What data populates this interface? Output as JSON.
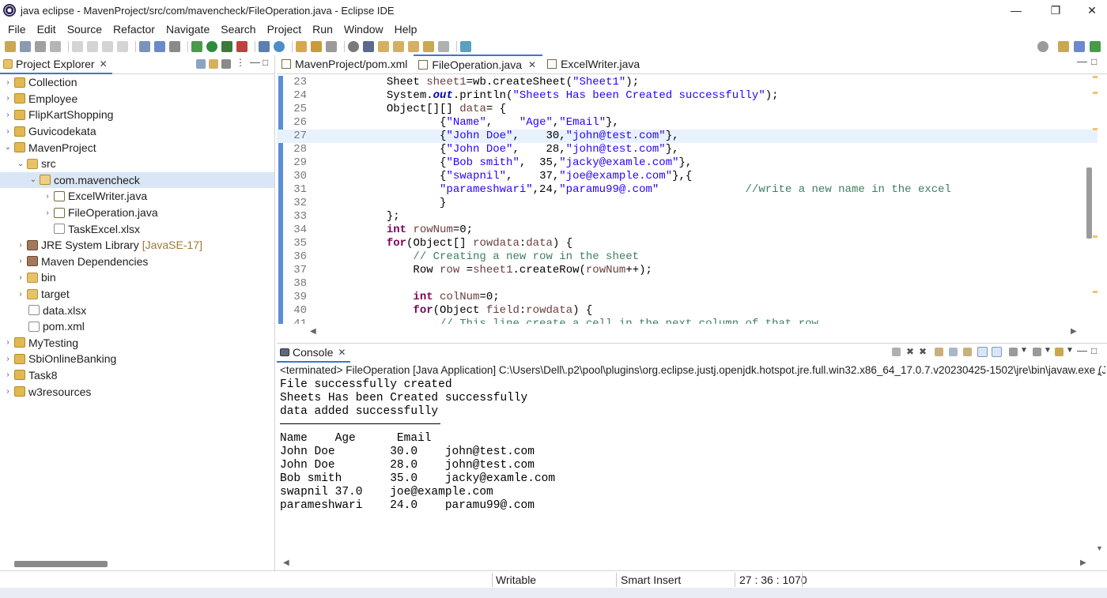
{
  "window": {
    "title": "java eclipse - MavenProject/src/com/mavencheck/FileOperation.java - Eclipse IDE",
    "minimize": "—",
    "maximize": "❐",
    "close": "✕"
  },
  "menu": [
    "File",
    "Edit",
    "Source",
    "Refactor",
    "Navigate",
    "Search",
    "Project",
    "Run",
    "Window",
    "Help"
  ],
  "project_explorer": {
    "tab_label": "Project Explorer",
    "items": [
      {
        "label": "Collection",
        "chev": "›",
        "icon": "project-icon"
      },
      {
        "label": "Employee",
        "chev": "›",
        "icon": "project-icon"
      },
      {
        "label": "FlipKartShopping",
        "chev": "›",
        "icon": "project-icon"
      },
      {
        "label": "Guvicodekata",
        "chev": "›",
        "icon": "project-icon"
      },
      {
        "label": "MavenProject",
        "chev": "⌄",
        "icon": "project-icon"
      },
      {
        "label": "src",
        "chev": "⌄",
        "icon": "folder-icon"
      },
      {
        "label": "com.mavencheck",
        "chev": "⌄",
        "icon": "package-icon"
      },
      {
        "label": "ExcelWriter.java",
        "chev": "›",
        "icon": "java-file-icon"
      },
      {
        "label": "FileOperation.java",
        "chev": "›",
        "icon": "java-file-icon"
      },
      {
        "label": "TaskExcel.xlsx",
        "chev": "",
        "icon": "xlsx-file-icon"
      },
      {
        "label": "JRE System Library",
        "suffix": "[JavaSE-17]",
        "chev": "›",
        "icon": "library-icon"
      },
      {
        "label": "Maven Dependencies",
        "chev": "›",
        "icon": "library-icon"
      },
      {
        "label": "bin",
        "chev": "›",
        "icon": "folder-icon"
      },
      {
        "label": "target",
        "chev": "›",
        "icon": "folder-icon"
      },
      {
        "label": "data.xlsx",
        "chev": "",
        "icon": "xlsx-file-icon"
      },
      {
        "label": "pom.xml",
        "chev": "",
        "icon": "xml-file-icon"
      },
      {
        "label": "MyTesting",
        "chev": "›",
        "icon": "project-icon"
      },
      {
        "label": "SbiOnlineBanking",
        "chev": "›",
        "icon": "project-icon"
      },
      {
        "label": "Task8",
        "chev": "›",
        "icon": "project-icon"
      },
      {
        "label": "w3resources",
        "chev": "›",
        "icon": "project-icon"
      }
    ]
  },
  "editor": {
    "tabs": [
      {
        "label": "MavenProject/pom.xml",
        "active": false
      },
      {
        "label": "FileOperation.java",
        "active": true
      },
      {
        "label": "ExcelWriter.java",
        "active": false
      }
    ],
    "line_numbers": [
      "23",
      "24",
      "25",
      "26",
      "27",
      "28",
      "29",
      "30",
      "31",
      "32",
      "33",
      "34",
      "35",
      "36",
      "37",
      "38",
      "39",
      "40",
      "41"
    ],
    "current_line": "27"
  },
  "console": {
    "tab_label": "Console",
    "description": "<terminated> FileOperation [Java Application] C:\\Users\\Dell\\.p2\\pool\\plugins\\org.eclipse.justj.openjdk.hotspot.jre.full.win32.x86_64_17.0.7.v20230425-1502\\jre\\bin\\javaw.exe  (Jun",
    "lines_before_rule": [
      "File successfully created",
      "Sheets Has been Created successfully",
      "data added successfully"
    ],
    "lines_after_rule": [
      "Name    Age      Email",
      "John Doe        30.0    john@test.com",
      "John Doe        28.0    john@test.com",
      "Bob smith       35.0    jacky@examle.com",
      "swapnil 37.0    joe@example.com",
      "parameshwari    24.0    paramu99@.com"
    ]
  },
  "status": {
    "writable": "Writable",
    "insert_mode": "Smart Insert",
    "position": "27 : 36 : 1070"
  }
}
